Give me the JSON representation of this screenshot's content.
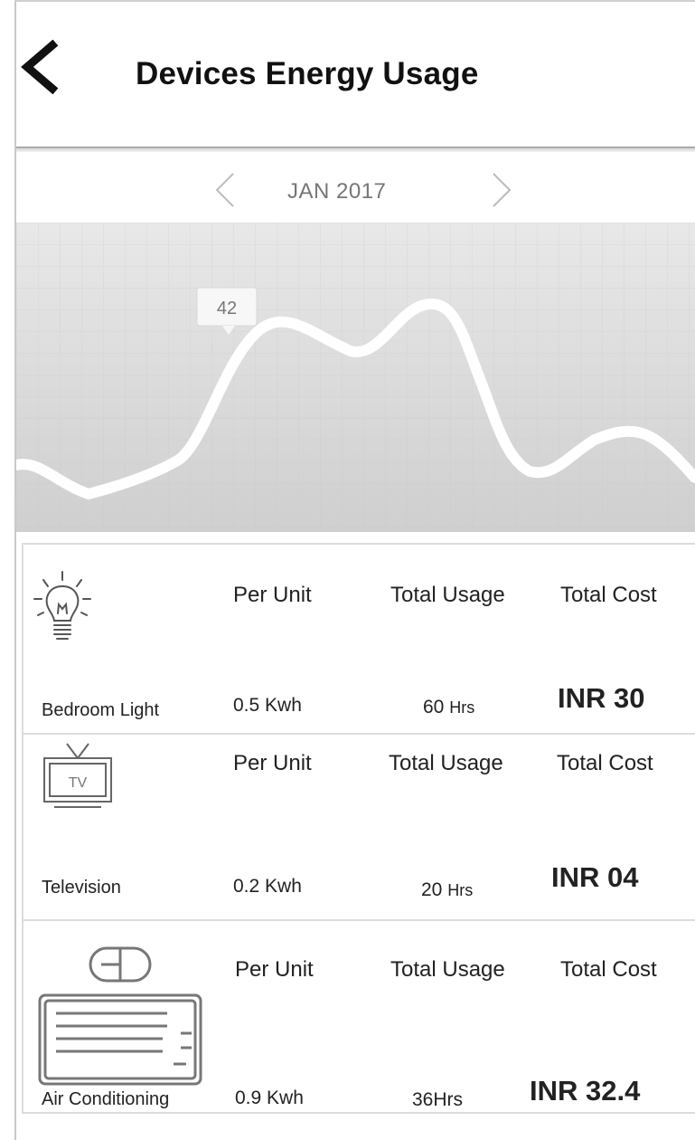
{
  "header": {
    "title": "Devices Energy Usage",
    "back_icon": "chevron-left-icon"
  },
  "period": {
    "month": "JAN 2017",
    "prev_icon": "chevron-left-icon",
    "next_icon": "chevron-right-icon"
  },
  "chart_data": {
    "type": "line",
    "highlight_label": "42",
    "grid": true,
    "colors": {
      "line": "#ffffff",
      "background": "#dcdcdc"
    }
  },
  "devices": [
    {
      "name": "Bedroom Light",
      "icon": "lightbulb-icon",
      "per_unit_header": "Per Unit",
      "total_usage_header": "Total Usage",
      "total_cost_header": "Total Cost",
      "per_unit": "0.5 Kwh",
      "usage_value": "60",
      "usage_unit": "Hrs",
      "cost": "INR 30"
    },
    {
      "name": "Television",
      "icon": "tv-icon",
      "icon_text": "TV",
      "per_unit_header": "Per Unit",
      "total_usage_header": "Total Usage",
      "total_cost_header": "Total Cost",
      "per_unit": "0.2 Kwh",
      "usage_value": "20",
      "usage_unit": "Hrs",
      "cost": "INR 04"
    },
    {
      "name": "Air Conditioning",
      "icon": "air-conditioner-icon",
      "per_unit_header": "Per Unit",
      "total_usage_header": "Total Usage",
      "total_cost_header": "Total Cost",
      "per_unit": "0.9 Kwh",
      "usage_value": "36Hrs",
      "usage_unit": "",
      "cost": "INR 32.4"
    }
  ]
}
